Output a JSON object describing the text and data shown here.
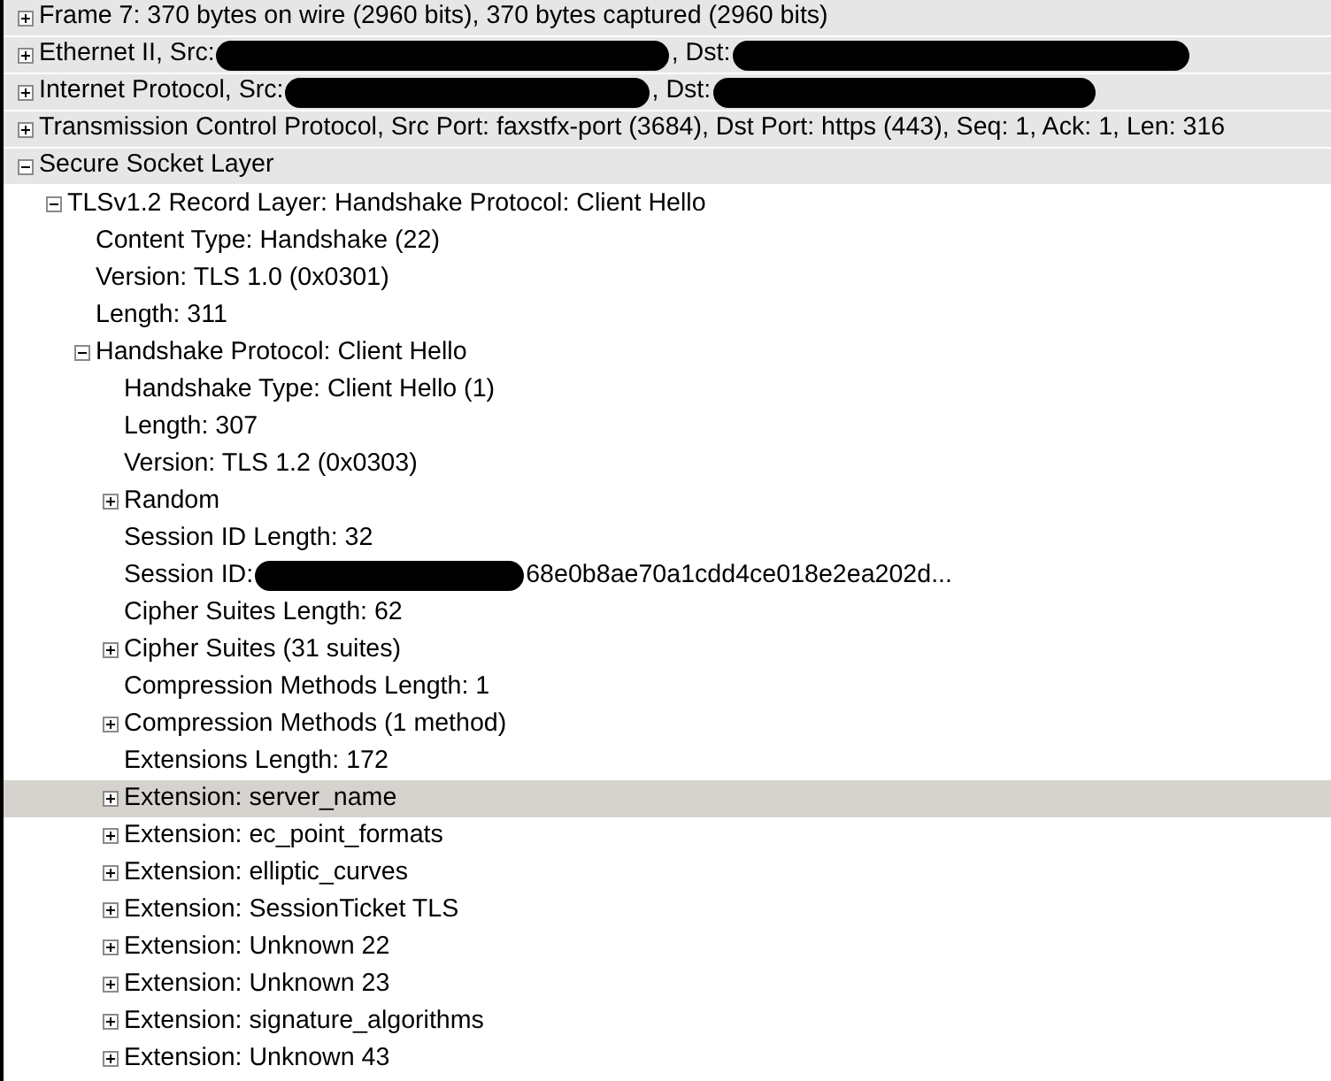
{
  "packet_details": [
    {
      "parts": [
        {
          "kind": "text",
          "text": "Frame 7: 370 bytes on wire (2960 bits), 370 bytes captured (2960 bits)"
        }
      ],
      "expanded": false,
      "selected": false
    },
    {
      "parts": [
        {
          "kind": "text",
          "text": "Ethernet II, Src:"
        },
        {
          "kind": "redacted"
        },
        {
          "kind": "text",
          "text": ", Dst:"
        },
        {
          "kind": "redacted"
        }
      ],
      "expanded": false,
      "selected": false
    },
    {
      "parts": [
        {
          "kind": "text",
          "text": "Internet Protocol, Src:"
        },
        {
          "kind": "redacted"
        },
        {
          "kind": "text",
          "text": ", Dst:"
        },
        {
          "kind": "redacted"
        }
      ],
      "expanded": false,
      "selected": false
    },
    {
      "parts": [
        {
          "kind": "text",
          "text": "Transmission Control Protocol, Src Port: faxstfx-port (3684), Dst Port: https (443), Seq: 1, Ack: 1, Len: 316"
        }
      ],
      "expanded": false,
      "selected": false
    },
    {
      "parts": [
        {
          "kind": "text",
          "text": "Secure Socket Layer"
        }
      ],
      "expanded": true,
      "selected": false,
      "children": [
        {
          "parts": [
            {
              "kind": "text",
              "text": "TLSv1.2 Record Layer: Handshake Protocol: Client Hello"
            }
          ],
          "expanded": true,
          "selected": false,
          "children": [
            {
              "parts": [
                {
                  "kind": "text",
                  "text": "Content Type: Handshake (22)"
                }
              ],
              "selected": false
            },
            {
              "parts": [
                {
                  "kind": "text",
                  "text": "Version: TLS 1.0 (0x0301)"
                }
              ],
              "selected": false
            },
            {
              "parts": [
                {
                  "kind": "text",
                  "text": "Length: 311"
                }
              ],
              "selected": false
            },
            {
              "parts": [
                {
                  "kind": "text",
                  "text": "Handshake Protocol: Client Hello"
                }
              ],
              "expanded": true,
              "selected": false,
              "children": [
                {
                  "parts": [
                    {
                      "kind": "text",
                      "text": "Handshake Type: Client Hello (1)"
                    }
                  ],
                  "selected": false
                },
                {
                  "parts": [
                    {
                      "kind": "text",
                      "text": "Length: 307"
                    }
                  ],
                  "selected": false
                },
                {
                  "parts": [
                    {
                      "kind": "text",
                      "text": "Version: TLS 1.2 (0x0303)"
                    }
                  ],
                  "selected": false
                },
                {
                  "parts": [
                    {
                      "kind": "text",
                      "text": "Random"
                    }
                  ],
                  "expanded": false,
                  "selected": false
                },
                {
                  "parts": [
                    {
                      "kind": "text",
                      "text": "Session ID Length: 32"
                    }
                  ],
                  "selected": false
                },
                {
                  "parts": [
                    {
                      "kind": "text",
                      "text": "Session ID:"
                    },
                    {
                      "kind": "redacted"
                    },
                    {
                      "kind": "text",
                      "text": "68e0b8ae70a1cdd4ce018e2ea202d..."
                    }
                  ],
                  "selected": false
                },
                {
                  "parts": [
                    {
                      "kind": "text",
                      "text": "Cipher Suites Length: 62"
                    }
                  ],
                  "selected": false
                },
                {
                  "parts": [
                    {
                      "kind": "text",
                      "text": "Cipher Suites (31 suites)"
                    }
                  ],
                  "expanded": false,
                  "selected": false
                },
                {
                  "parts": [
                    {
                      "kind": "text",
                      "text": "Compression Methods Length: 1"
                    }
                  ],
                  "selected": false
                },
                {
                  "parts": [
                    {
                      "kind": "text",
                      "text": "Compression Methods (1 method)"
                    }
                  ],
                  "expanded": false,
                  "selected": false
                },
                {
                  "parts": [
                    {
                      "kind": "text",
                      "text": "Extensions Length: 172"
                    }
                  ],
                  "selected": false
                },
                {
                  "parts": [
                    {
                      "kind": "text",
                      "text": "Extension: server_name"
                    }
                  ],
                  "expanded": false,
                  "selected": true
                },
                {
                  "parts": [
                    {
                      "kind": "text",
                      "text": "Extension: ec_point_formats"
                    }
                  ],
                  "expanded": false,
                  "selected": false
                },
                {
                  "parts": [
                    {
                      "kind": "text",
                      "text": "Extension: elliptic_curves"
                    }
                  ],
                  "expanded": false,
                  "selected": false
                },
                {
                  "parts": [
                    {
                      "kind": "text",
                      "text": "Extension: SessionTicket TLS"
                    }
                  ],
                  "expanded": false,
                  "selected": false
                },
                {
                  "parts": [
                    {
                      "kind": "text",
                      "text": "Extension: Unknown 22"
                    }
                  ],
                  "expanded": false,
                  "selected": false
                },
                {
                  "parts": [
                    {
                      "kind": "text",
                      "text": "Extension: Unknown 23"
                    }
                  ],
                  "expanded": false,
                  "selected": false
                },
                {
                  "parts": [
                    {
                      "kind": "text",
                      "text": "Extension: signature_algorithms"
                    }
                  ],
                  "expanded": false,
                  "selected": false
                },
                {
                  "parts": [
                    {
                      "kind": "text",
                      "text": "Extension: Unknown 43"
                    }
                  ],
                  "expanded": false,
                  "selected": false
                }
              ]
            }
          ]
        }
      ]
    }
  ]
}
